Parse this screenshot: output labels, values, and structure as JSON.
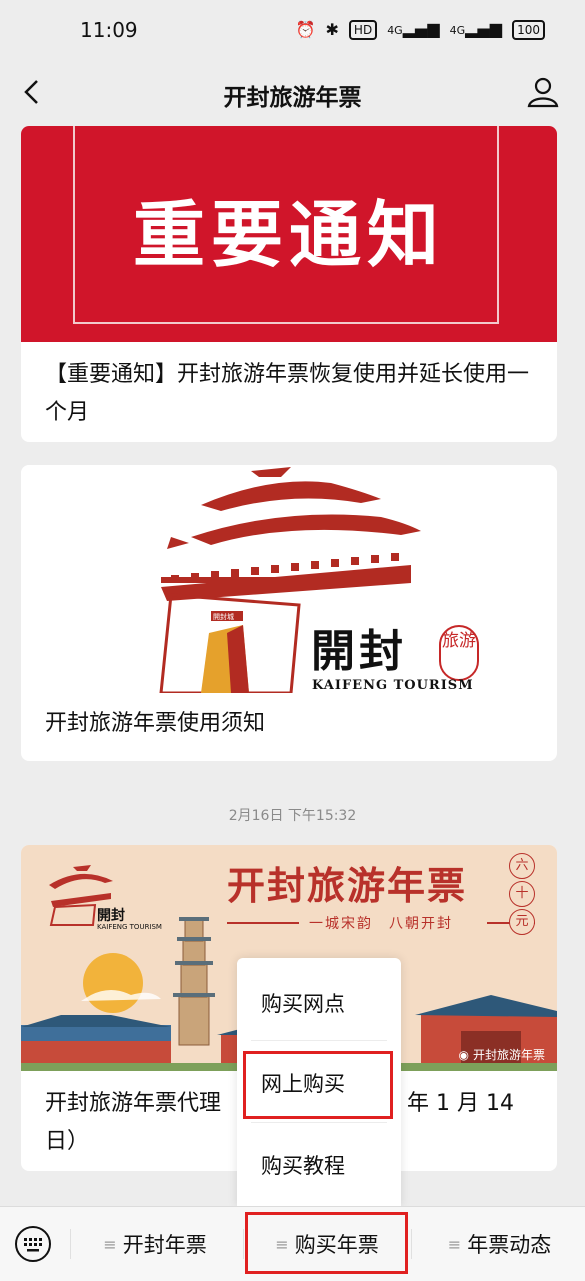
{
  "status_bar": {
    "time": "11:09",
    "icons": [
      "alarm-icon",
      "bluetooth-icon",
      "hd-icon",
      "signal-icon",
      "signal-icon",
      "battery-icon"
    ],
    "network_labels": [
      "4G",
      "4G"
    ],
    "hd_label": "HD",
    "battery_label": "100"
  },
  "nav": {
    "title": "开封旅游年票"
  },
  "cards": [
    {
      "banner_text": "重要通知",
      "text": "【重要通知】开封旅游年票恢复使用并延长使用一个月"
    },
    {
      "logo_calligraphy": "開封",
      "logo_seal": "旅游",
      "logo_english": "KAIFENG TOURISM",
      "gate_plaque": "開封城",
      "text": "开封旅游年票使用须知"
    },
    {
      "poster_title": "开封旅游年票",
      "poster_subtitle": "一城宋韵　八朝开封",
      "poster_price": [
        "六",
        "十",
        "元"
      ],
      "poster_logo": "開封",
      "poster_logo_en": "KAIFENG TOURISM",
      "watermark": "开封旅游年票",
      "text_left": "开封旅游年票代理",
      "text_right": "年 1 月 14",
      "text_line2": "日）"
    }
  ],
  "timestamp": "2月16日 下午15:32",
  "menu": {
    "items": [
      "购买网点",
      "网上购买",
      "购买教程"
    ]
  },
  "tabbar": {
    "tabs": [
      "开封年票",
      "购买年票",
      "年票动态"
    ],
    "ham": "≡"
  },
  "colors": {
    "banner_red": "#d0152a",
    "highlight_red": "#e02020",
    "poster_bg": "#f4dcc5",
    "poster_text": "#b8312a"
  }
}
